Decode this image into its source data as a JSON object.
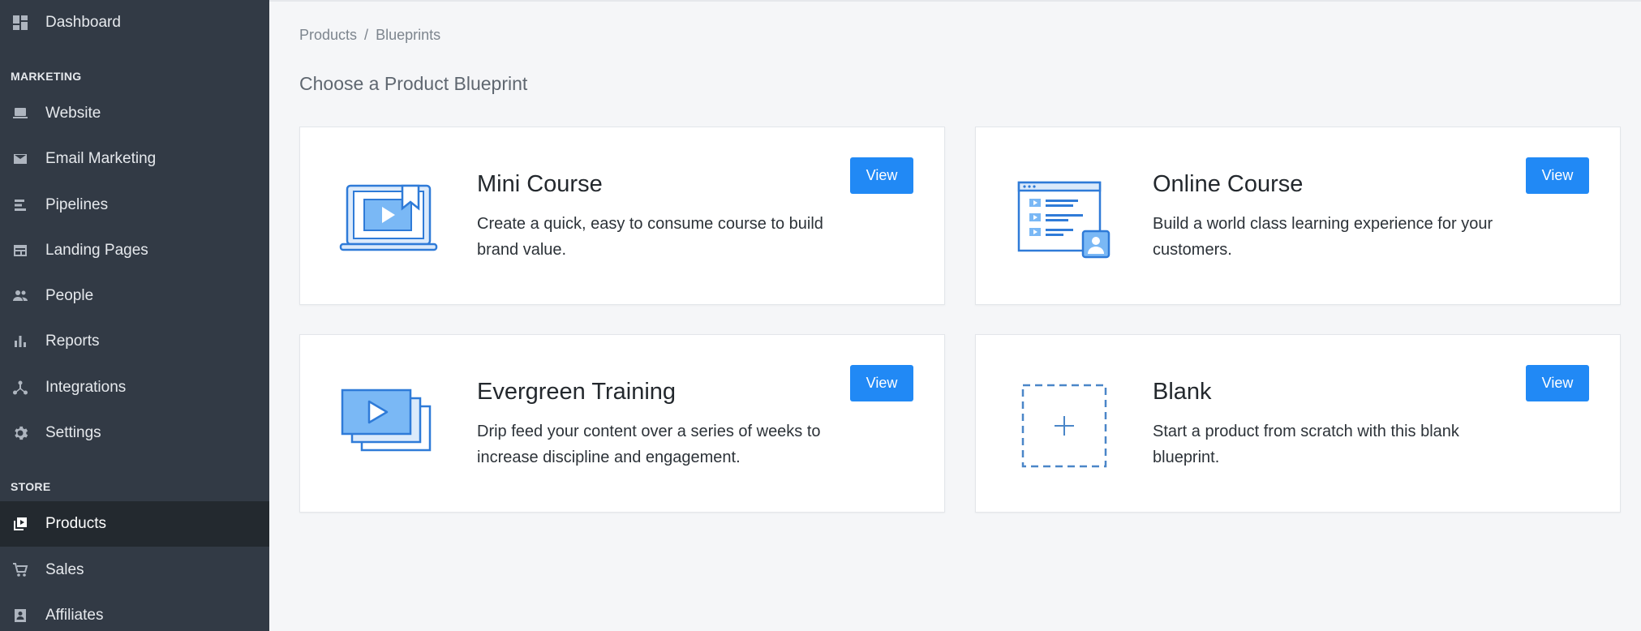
{
  "sidebar": {
    "items": {
      "dashboard": {
        "label": "Dashboard",
        "icon": "dashboard-icon"
      },
      "website": {
        "label": "Website",
        "icon": "laptop-icon"
      },
      "email": {
        "label": "Email Marketing",
        "icon": "envelope-icon"
      },
      "pipelines": {
        "label": "Pipelines",
        "icon": "pipelines-icon"
      },
      "landing": {
        "label": "Landing Pages",
        "icon": "landing-page-icon"
      },
      "people": {
        "label": "People",
        "icon": "people-icon"
      },
      "reports": {
        "label": "Reports",
        "icon": "bar-chart-icon"
      },
      "integrations": {
        "label": "Integrations",
        "icon": "integrations-icon"
      },
      "settings": {
        "label": "Settings",
        "icon": "gear-icon"
      },
      "products": {
        "label": "Products",
        "icon": "products-icon",
        "active": true
      },
      "sales": {
        "label": "Sales",
        "icon": "cart-icon"
      },
      "affiliates": {
        "label": "Affiliates",
        "icon": "contact-card-icon"
      }
    },
    "sections": {
      "marketing": "MARKETING",
      "store": "STORE"
    }
  },
  "breadcrumb": {
    "parent": "Products",
    "separator": "/",
    "current": "Blueprints"
  },
  "page_title": "Choose a Product Blueprint",
  "cards": {
    "mini": {
      "title": "Mini Course",
      "description": "Create a quick, easy to consume course to build brand value.",
      "button": "View",
      "icon": "laptop-video-icon"
    },
    "online": {
      "title": "Online Course",
      "description": "Build a world class learning experience for your customers.",
      "button": "View",
      "icon": "course-window-icon"
    },
    "evergreen": {
      "title": "Evergreen Training",
      "description": "Drip feed your content over a series of weeks to increase discipline and engagement.",
      "button": "View",
      "icon": "stacked-videos-icon"
    },
    "blank": {
      "title": "Blank",
      "description": "Start a product from scratch with this blank blueprint.",
      "button": "View",
      "icon": "plus-dashed-icon"
    }
  },
  "colors": {
    "sidebar_bg": "#323a45",
    "sidebar_active_bg": "#23292f",
    "accent": "#2189f5",
    "illustration_stroke": "#2f7bd8",
    "illustration_fill": "#7ab8f5"
  }
}
